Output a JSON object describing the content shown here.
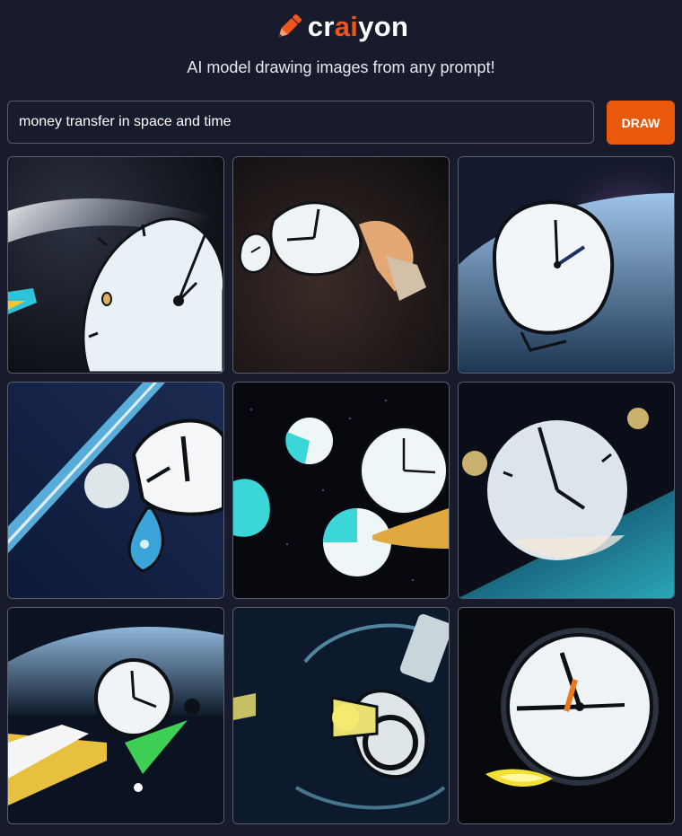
{
  "header": {
    "logo_part1": "cr",
    "logo_part2": "ai",
    "logo_part3": "yon",
    "tagline": "AI model drawing images from any prompt!"
  },
  "prompt": {
    "value": "money transfer in space and time",
    "draw_label": "DRAW"
  },
  "colors": {
    "background": "#171b2b",
    "accent": "#ea580c",
    "input_border": "#555a69"
  },
  "results": [
    {
      "subject": "melting clock in space"
    },
    {
      "subject": "hand holding melting clock"
    },
    {
      "subject": "clock above earth"
    },
    {
      "subject": "clock with water drop"
    },
    {
      "subject": "floating clocks and coins"
    },
    {
      "subject": "clock with coins over earth"
    },
    {
      "subject": "clock on yellow rocket"
    },
    {
      "subject": "yellow bottle satellite"
    },
    {
      "subject": "clock with yellow flame"
    }
  ]
}
